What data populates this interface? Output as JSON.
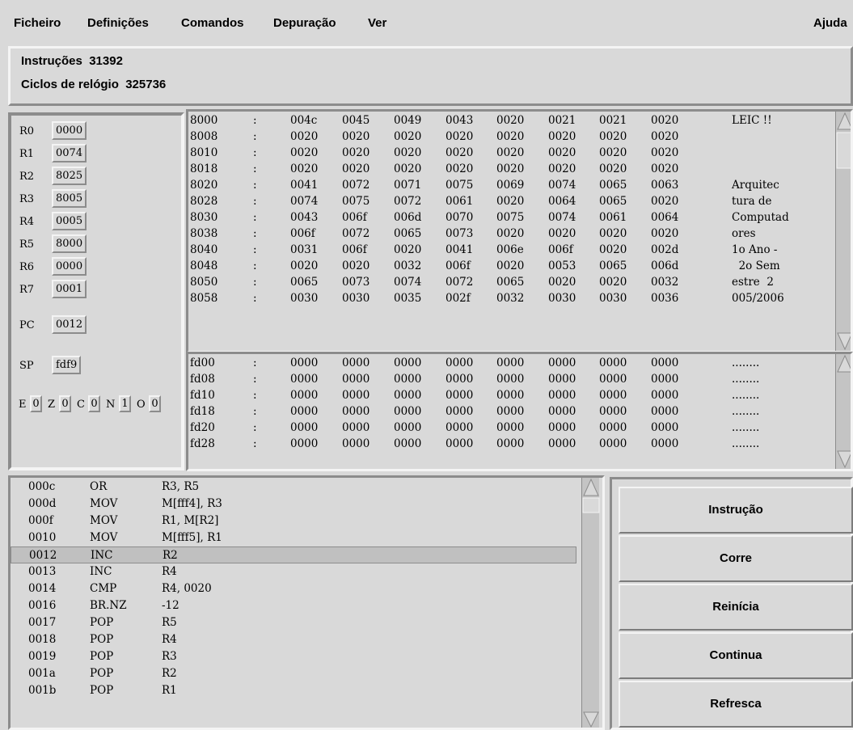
{
  "menu": [
    "Ficheiro",
    "Definições",
    "Comandos",
    "Depuração",
    "Ver"
  ],
  "help": "Ajuda",
  "counters": {
    "instr_label": "Instruções",
    "instr_value": "31392",
    "cycles_label": "Ciclos de relógio",
    "cycles_value": "325736"
  },
  "registers": [
    {
      "name": "R0",
      "value": "0000"
    },
    {
      "name": "R1",
      "value": "0074"
    },
    {
      "name": "R2",
      "value": "8025"
    },
    {
      "name": "R3",
      "value": "8005"
    },
    {
      "name": "R4",
      "value": "0005"
    },
    {
      "name": "R5",
      "value": "8000"
    },
    {
      "name": "R6",
      "value": "0000"
    },
    {
      "name": "R7",
      "value": "0001"
    }
  ],
  "pc": {
    "name": "PC",
    "value": "0012"
  },
  "sp": {
    "name": "SP",
    "value": "fdf9"
  },
  "flags": [
    {
      "name": "E",
      "value": "0"
    },
    {
      "name": "Z",
      "value": "0"
    },
    {
      "name": "C",
      "value": "0"
    },
    {
      "name": "N",
      "value": "1"
    },
    {
      "name": "O",
      "value": "0"
    }
  ],
  "memory_top": [
    {
      "addr": "8000",
      "words": [
        "004c",
        "0045",
        "0049",
        "0043",
        "0020",
        "0021",
        "0021",
        "0020"
      ],
      "ascii": "LEIC !!"
    },
    {
      "addr": "8008",
      "words": [
        "0020",
        "0020",
        "0020",
        "0020",
        "0020",
        "0020",
        "0020",
        "0020"
      ],
      "ascii": ""
    },
    {
      "addr": "8010",
      "words": [
        "0020",
        "0020",
        "0020",
        "0020",
        "0020",
        "0020",
        "0020",
        "0020"
      ],
      "ascii": ""
    },
    {
      "addr": "8018",
      "words": [
        "0020",
        "0020",
        "0020",
        "0020",
        "0020",
        "0020",
        "0020",
        "0020"
      ],
      "ascii": ""
    },
    {
      "addr": "8020",
      "words": [
        "0041",
        "0072",
        "0071",
        "0075",
        "0069",
        "0074",
        "0065",
        "0063"
      ],
      "ascii": "Arquitec"
    },
    {
      "addr": "8028",
      "words": [
        "0074",
        "0075",
        "0072",
        "0061",
        "0020",
        "0064",
        "0065",
        "0020"
      ],
      "ascii": "tura de"
    },
    {
      "addr": "8030",
      "words": [
        "0043",
        "006f",
        "006d",
        "0070",
        "0075",
        "0074",
        "0061",
        "0064"
      ],
      "ascii": "Computad"
    },
    {
      "addr": "8038",
      "words": [
        "006f",
        "0072",
        "0065",
        "0073",
        "0020",
        "0020",
        "0020",
        "0020"
      ],
      "ascii": "ores"
    },
    {
      "addr": "8040",
      "words": [
        "0031",
        "006f",
        "0020",
        "0041",
        "006e",
        "006f",
        "0020",
        "002d"
      ],
      "ascii": "1o Ano -"
    },
    {
      "addr": "8048",
      "words": [
        "0020",
        "0020",
        "0032",
        "006f",
        "0020",
        "0053",
        "0065",
        "006d"
      ],
      "ascii": "  2o Sem"
    },
    {
      "addr": "8050",
      "words": [
        "0065",
        "0073",
        "0074",
        "0072",
        "0065",
        "0020",
        "0020",
        "0032"
      ],
      "ascii": "estre  2"
    },
    {
      "addr": "8058",
      "words": [
        "0030",
        "0030",
        "0035",
        "002f",
        "0032",
        "0030",
        "0030",
        "0036"
      ],
      "ascii": "005/2006"
    }
  ],
  "memory_stack": [
    {
      "addr": "fd00",
      "words": [
        "0000",
        "0000",
        "0000",
        "0000",
        "0000",
        "0000",
        "0000",
        "0000"
      ],
      "ascii": "........"
    },
    {
      "addr": "fd08",
      "words": [
        "0000",
        "0000",
        "0000",
        "0000",
        "0000",
        "0000",
        "0000",
        "0000"
      ],
      "ascii": "........"
    },
    {
      "addr": "fd10",
      "words": [
        "0000",
        "0000",
        "0000",
        "0000",
        "0000",
        "0000",
        "0000",
        "0000"
      ],
      "ascii": "........"
    },
    {
      "addr": "fd18",
      "words": [
        "0000",
        "0000",
        "0000",
        "0000",
        "0000",
        "0000",
        "0000",
        "0000"
      ],
      "ascii": "........"
    },
    {
      "addr": "fd20",
      "words": [
        "0000",
        "0000",
        "0000",
        "0000",
        "0000",
        "0000",
        "0000",
        "0000"
      ],
      "ascii": "........"
    },
    {
      "addr": "fd28",
      "words": [
        "0000",
        "0000",
        "0000",
        "0000",
        "0000",
        "0000",
        "0000",
        "0000"
      ],
      "ascii": "........"
    }
  ],
  "separator": ":",
  "code": [
    {
      "addr": "000c",
      "op": "OR",
      "args": "R3, R5"
    },
    {
      "addr": "000d",
      "op": "MOV",
      "args": "M[fff4], R3"
    },
    {
      "addr": "000f",
      "op": "MOV",
      "args": "R1, M[R2]"
    },
    {
      "addr": "0010",
      "op": "MOV",
      "args": "M[fff5], R1"
    },
    {
      "addr": "0012",
      "op": "INC",
      "args": "R2",
      "current": true
    },
    {
      "addr": "0013",
      "op": "INC",
      "args": "R4"
    },
    {
      "addr": "0014",
      "op": "CMP",
      "args": "R4, 0020"
    },
    {
      "addr": "0016",
      "op": "BR.NZ",
      "args": "-12"
    },
    {
      "addr": "0017",
      "op": "POP",
      "args": "R5"
    },
    {
      "addr": "0018",
      "op": "POP",
      "args": "R4"
    },
    {
      "addr": "0019",
      "op": "POP",
      "args": "R3"
    },
    {
      "addr": "001a",
      "op": "POP",
      "args": "R2"
    },
    {
      "addr": "001b",
      "op": "POP",
      "args": "R1"
    }
  ],
  "buttons": [
    "Instrução",
    "Corre",
    "Reinícia",
    "Continua",
    "Refresca"
  ]
}
